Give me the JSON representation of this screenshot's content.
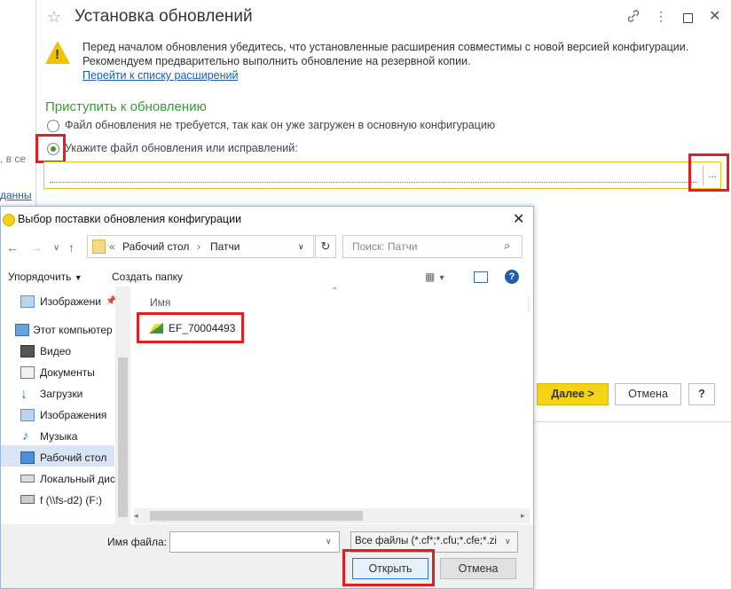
{
  "main_window": {
    "title": "Установка обновлений",
    "warning_line1": "Перед началом обновления убедитесь, что установленные расширения совместимы с новой версией конфигурации.",
    "warning_line2": "Рекомендуем предварительно выполнить обновление на резервной копии.",
    "extensions_link": "Перейти к списку расширений",
    "section_title": "Приступить к обновлению",
    "option1": "Файл обновления не требуется, так как он уже загружен в основную конфигурацию",
    "option2": "Укажите файл обновления или исправлений:",
    "browse_label": "...",
    "next_button": "Далее >",
    "cancel_button": "Отмена",
    "help_button": "?",
    "left_edge_text1": ", в се",
    "left_edge_text2": "данны"
  },
  "dialog": {
    "title": "Выбор поставки обновления конфигурации",
    "breadcrumb_prefix": "«",
    "breadcrumb": [
      "Рабочий стол",
      "Патчи"
    ],
    "search_placeholder": "Поиск: Патчи",
    "organize": "Упорядочить",
    "new_folder": "Создать папку",
    "column_name": "Имя",
    "sidebar": [
      {
        "label": "Изображени",
        "icon": "pictures-icon"
      },
      {
        "label": "Этот компьютер",
        "icon": "computer-icon"
      },
      {
        "label": "Видео",
        "icon": "video-icon"
      },
      {
        "label": "Документы",
        "icon": "documents-icon"
      },
      {
        "label": "Загрузки",
        "icon": "downloads-icon"
      },
      {
        "label": "Изображения",
        "icon": "pictures-icon"
      },
      {
        "label": "Музыка",
        "icon": "music-icon"
      },
      {
        "label": "Рабочий стол",
        "icon": "desktop-icon"
      },
      {
        "label": "Локальный дис",
        "icon": "disk-icon"
      },
      {
        "label": "f (\\\\fs-d2) (F:)",
        "icon": "network-drive-icon"
      }
    ],
    "files": [
      {
        "name": "EF_70004493",
        "icon": "cf-file-icon"
      }
    ],
    "filename_label": "Имя файла:",
    "filename_value": "",
    "filetype_value": "Все файлы (*.cf*;*.cfu;*.cfe;*.zi",
    "open_button": "Открыть",
    "cancel_button": "Отмена"
  },
  "colors": {
    "accent_green": "#3a9a3a",
    "highlight_red": "#e02020",
    "next_yellow": "#f5d315",
    "link_blue": "#1b5fa8"
  }
}
